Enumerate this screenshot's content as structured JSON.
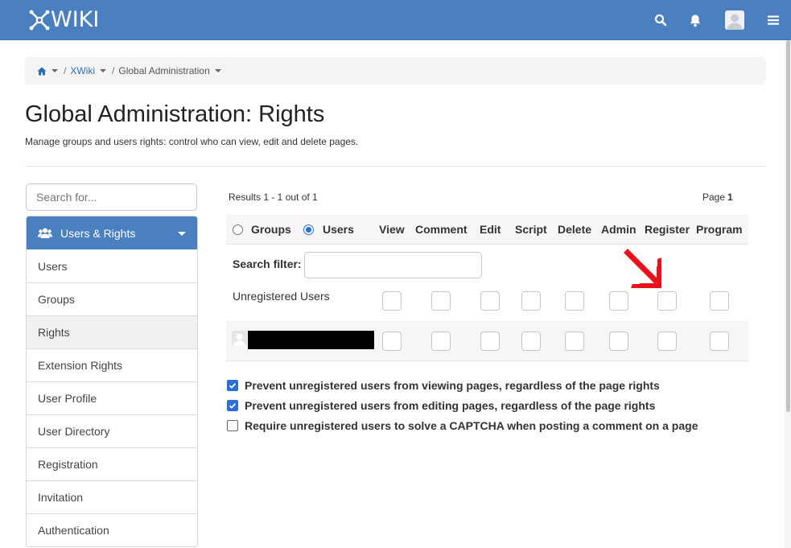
{
  "app": {
    "logo_text": "WIKI"
  },
  "breadcrumb": {
    "items": [
      "XWiki",
      "Global Administration"
    ],
    "separator": "/"
  },
  "page": {
    "title": "Global Administration: Rights",
    "subtitle": "Manage groups and users rights: control who can view, edit and delete pages."
  },
  "sidebar": {
    "search_placeholder": "Search for...",
    "section_title": "Users & Rights",
    "items": [
      "Users",
      "Groups",
      "Rights",
      "Extension Rights",
      "User Profile",
      "User Directory",
      "Registration",
      "Invitation",
      "Authentication"
    ],
    "active_item": "Rights"
  },
  "results": {
    "text": "Results 1 - 1 out of 1",
    "page_label": "Page",
    "page_number": "1"
  },
  "table": {
    "type_options": {
      "groups": "Groups",
      "users": "Users",
      "selected": "Users"
    },
    "columns": [
      "View",
      "Comment",
      "Edit",
      "Script",
      "Delete",
      "Admin",
      "Register",
      "Program"
    ],
    "filter_label": "Search filter:",
    "filter_value": "",
    "rows": [
      {
        "label": "Unregistered Users"
      },
      {
        "label": ""
      }
    ]
  },
  "options": [
    {
      "label": "Prevent unregistered users from viewing pages, regardless of the page rights",
      "checked": true
    },
    {
      "label": "Prevent unregistered users from editing pages, regardless of the page rights",
      "checked": true
    },
    {
      "label": "Require unregistered users to solve a CAPTCHA when posting a comment on a page",
      "checked": false
    }
  ],
  "colors": {
    "brand": "#4a80c0",
    "link": "#2a6eb0",
    "checkbox": "#2a6fd4",
    "annotation_arrow": "#e8131a"
  },
  "icons": {
    "top_bar": [
      "search-icon",
      "bell-icon",
      "avatar",
      "menu-icon"
    ],
    "breadcrumb_home": "home-icon",
    "sidebar_section": "users-icon",
    "annotation": "red-arrow-icon"
  }
}
